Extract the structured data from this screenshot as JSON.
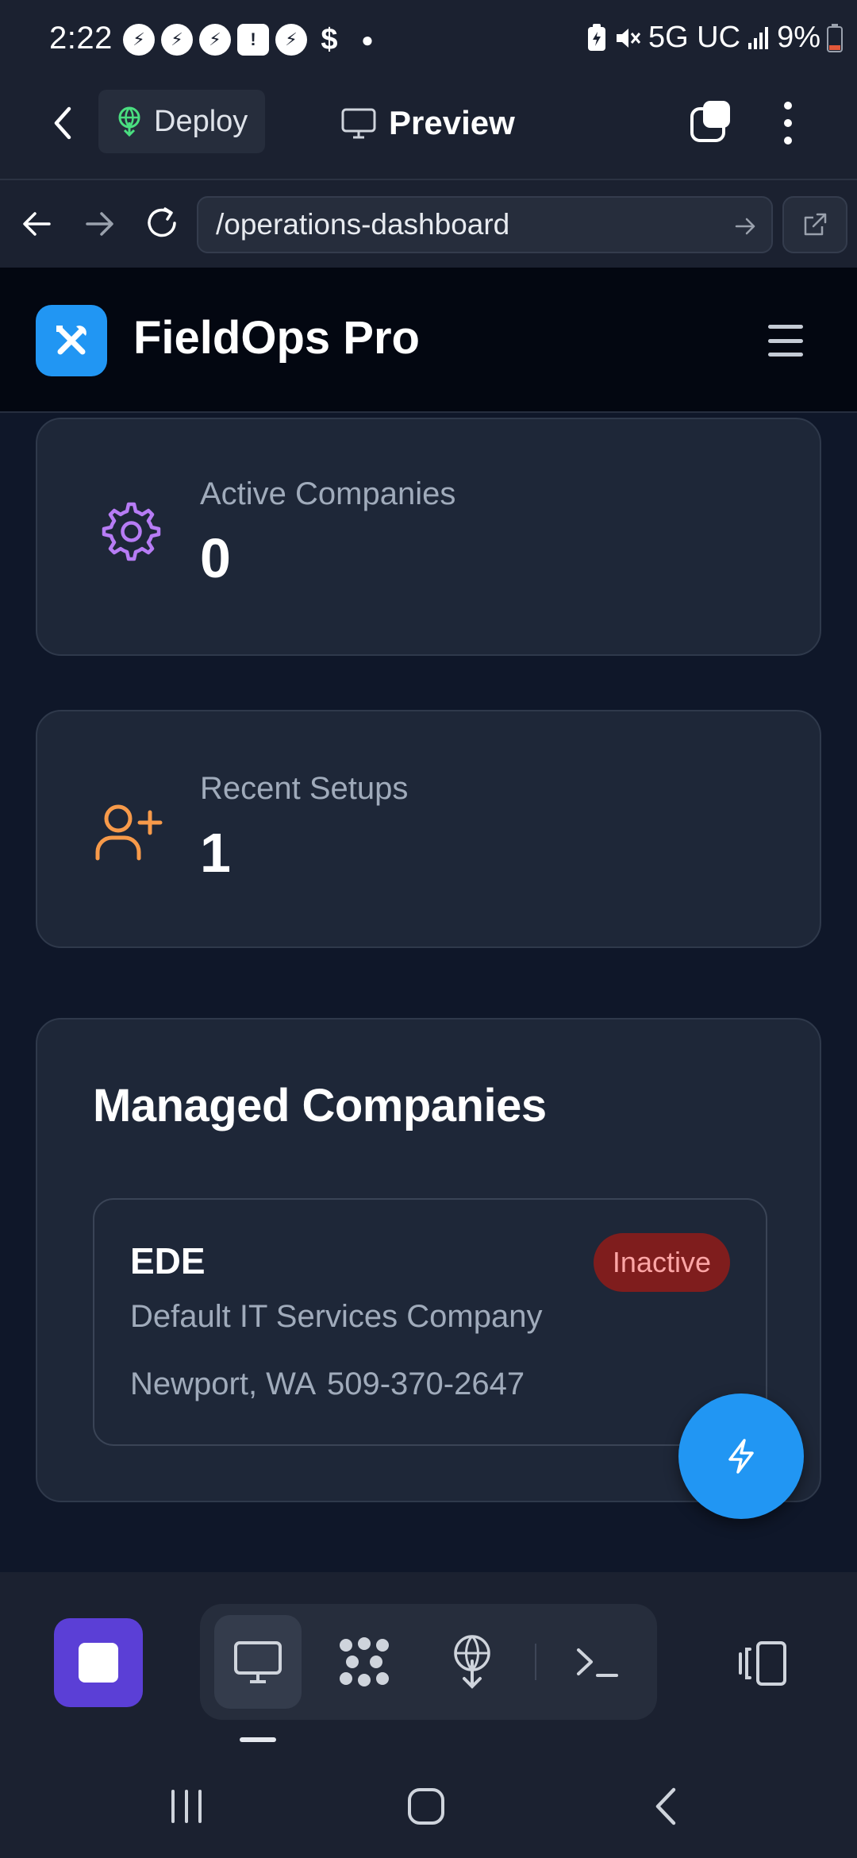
{
  "status_bar": {
    "time": "2:22",
    "network": "5G UC",
    "battery": "9%",
    "notification_icons": [
      "messenger-icon",
      "messenger-icon",
      "messenger-icon",
      "alert-icon",
      "messenger-icon",
      "dollar-icon",
      "dot-icon"
    ]
  },
  "toolbar": {
    "deploy_label": "Deploy",
    "preview_label": "Preview"
  },
  "address_bar": {
    "url": "/operations-dashboard"
  },
  "site_header": {
    "brand": "FieldOps Pro",
    "logo_color": "#2196f3"
  },
  "stats": [
    {
      "label": "Active Companies",
      "value": "0",
      "icon": "gear-icon",
      "icon_color": "#b77cf5"
    },
    {
      "label": "Recent Setups",
      "value": "1",
      "icon": "user-plus-icon",
      "icon_color": "#f79a4a"
    }
  ],
  "managed_companies": {
    "title": "Managed Companies",
    "companies": [
      {
        "name": "EDE",
        "status": "Inactive",
        "description": "Default IT Services Company",
        "location": "Newport, WA",
        "phone": "509-370-2647"
      }
    ]
  },
  "bottom_toolbar": {
    "tools": [
      "monitor-icon",
      "grid-dots-icon",
      "deploy-icon",
      "terminal-icon"
    ],
    "active_tool": "monitor-icon",
    "stop_color": "#5b3fd6"
  },
  "colors": {
    "page_bg": "#0f1729",
    "card_bg": "#1e2738",
    "inactive_badge_bg": "#7f1d1d",
    "inactive_badge_text": "#fca5a5"
  }
}
